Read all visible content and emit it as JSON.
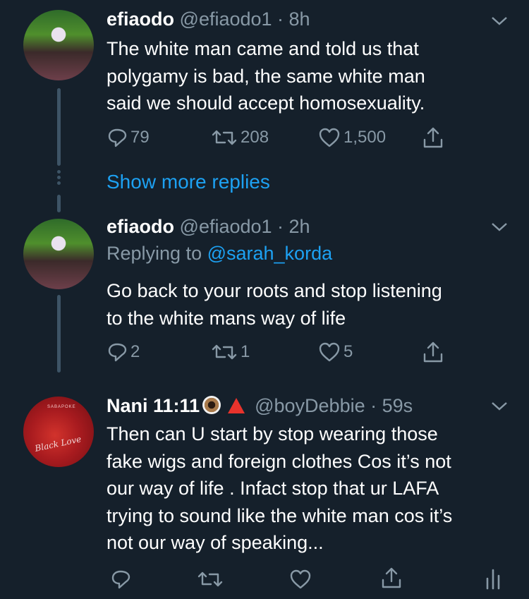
{
  "tweets": [
    {
      "name": "efiaodo",
      "handle": "@efiaodo1 · 8h",
      "text": [
        "The white man came and told us that",
        "polygamy is bad, the same white man",
        "said we should accept homosexuality."
      ],
      "replies": "79",
      "retweets": "208",
      "likes": "1,500"
    },
    {
      "name": "efiaodo",
      "handle": "@efiaodo1 · 2h",
      "replying_prefix": "Replying to ",
      "replying_to": "@sarah_korda",
      "text": [
        "Go back to your roots and stop listening",
        "to the white mans way of life"
      ],
      "replies": "2",
      "retweets": "1",
      "likes": "5"
    },
    {
      "name": "Nani 11:11",
      "handle": "@boyDebbie · 59s",
      "text": [
        "Then can U start by stop wearing those",
        "fake wigs and foreign clothes Cos it’s not",
        "our way of life . Infact stop that ur LAFA",
        "trying to sound like the white man cos it’s",
        "not our way of speaking..."
      ],
      "avatar_top_text": "SABAPOKE",
      "avatar_logo_text": "Black Love"
    }
  ],
  "show_more_replies": "Show more replies",
  "icons": [
    "chevron-down-icon",
    "reply-icon",
    "retweet-icon",
    "like-icon",
    "share-icon",
    "analytics-icon",
    "eye-emoji-icon",
    "red-triangle-emoji-icon"
  ],
  "colors": {
    "background": "#15202b",
    "muted": "#8899a6",
    "accent": "#1da1f2",
    "thread_line": "#3d5466"
  }
}
